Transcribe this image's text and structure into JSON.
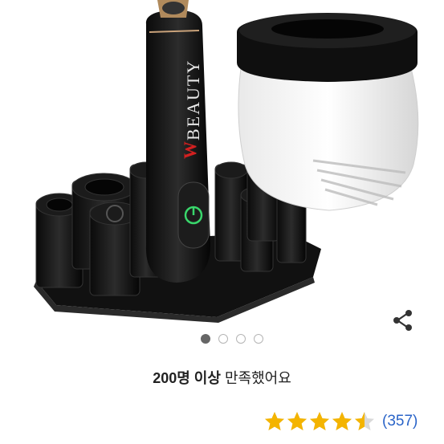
{
  "product": {
    "brand_text": "BEAUTY",
    "brand_initial": "W",
    "gallery": {
      "total": 4,
      "active": 1
    }
  },
  "summary": {
    "bold_text": "200명 이상",
    "rest_text": "만족했어요"
  },
  "rating": {
    "stars": 4.5,
    "count_text": "(357)"
  },
  "icons": {
    "share": "share-icon",
    "star": "star-icon"
  },
  "colors": {
    "star": "#f4b400",
    "link": "#2a64c8",
    "dot_active": "#666666"
  }
}
